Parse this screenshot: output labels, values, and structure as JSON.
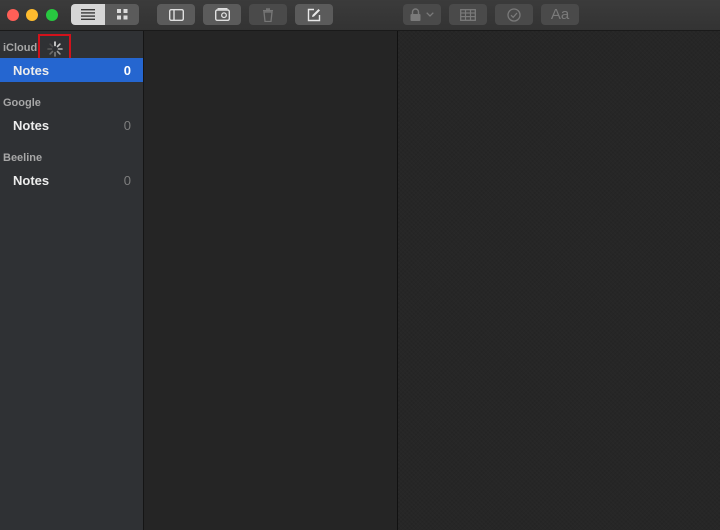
{
  "sidebar": {
    "groups": [
      {
        "header": "iCloud",
        "folder": {
          "label": "Notes",
          "count": "0",
          "selected": true
        }
      },
      {
        "header": "Google",
        "folder": {
          "label": "Notes",
          "count": "0",
          "selected": false
        }
      },
      {
        "header": "Beeline",
        "folder": {
          "label": "Notes",
          "count": "0",
          "selected": false
        }
      }
    ]
  },
  "toolbar": {
    "format_label": "Aa"
  },
  "colors": {
    "selection": "#2566d0",
    "highlight_box": "#d1121b"
  }
}
